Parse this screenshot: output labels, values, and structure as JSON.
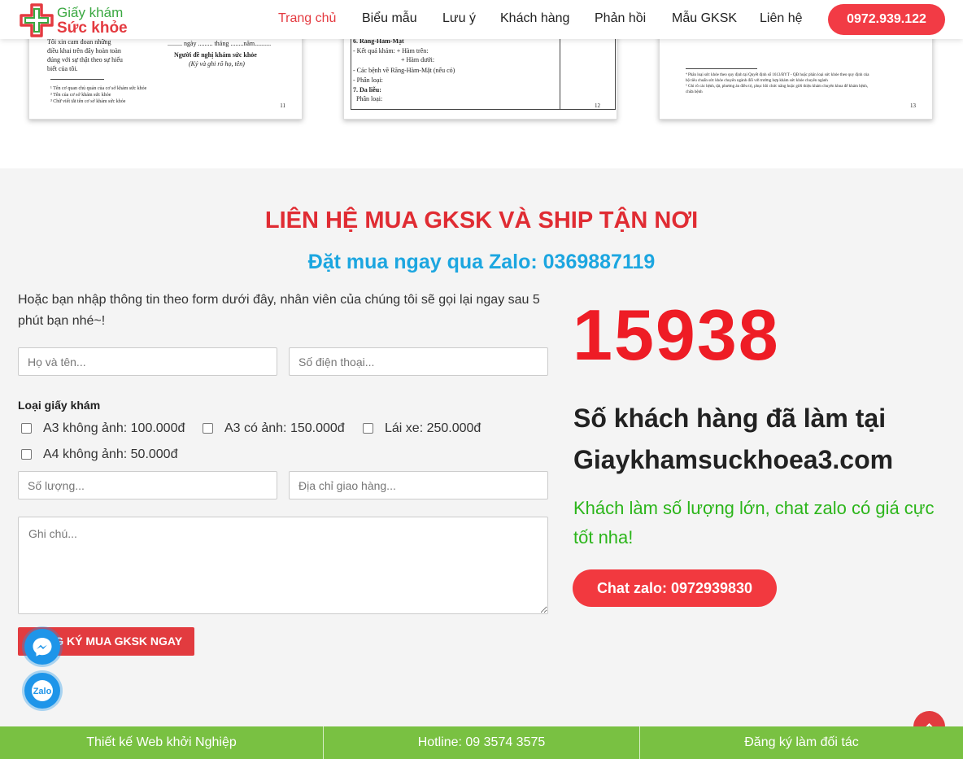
{
  "header": {
    "logo": {
      "line1": "Giấy khám",
      "line2": "Sức khỏe"
    },
    "nav": [
      {
        "label": "Trang chủ",
        "active": true
      },
      {
        "label": "Biểu mẫu",
        "active": false
      },
      {
        "label": "Lưu ý",
        "active": false
      },
      {
        "label": "Khách hàng",
        "active": false
      },
      {
        "label": "Phản hồi",
        "active": false
      },
      {
        "label": "Mẫu GKSK",
        "active": false
      },
      {
        "label": "Liên hệ",
        "active": false
      }
    ],
    "phone_button": "0972.939.122"
  },
  "documents": [
    {
      "page": "11",
      "lines": [
        "Tôi xin cam đoan những",
        "điều khai trên đây hoàn toàn",
        "đúng với sự thật theo sự hiểu",
        "biết của tôi.",
        "......... ngày ......... tháng ........năm..........",
        "Người đề nghị khám sức khỏe",
        "(Ký và ghi rõ họ, tên)",
        "¹ Tên cơ quan chủ quản của cơ sở khám sức khỏe",
        "² Tên của cơ sở khám sức khỏe",
        "³ Chữ viết tắt tên cơ sở khám sức khỏe"
      ]
    },
    {
      "page": "12",
      "lines": [
        "6. Răng-Hàm-Mặt",
        "- Kết quả khám: + Hàm trên:",
        "+ Hàm dưới:",
        "- Các bệnh về Răng-Hàm-Mặt (nếu có)",
        "- Phân loại:",
        "7. Da liễu:",
        "Phân loại:"
      ]
    },
    {
      "page": "13",
      "lines": [
        "⁴ Phân loại sức khỏe theo quy định tại Quyết định số 1613/BYT - QĐ hoặc phân loại sức khỏe theo quy định của",
        "bộ tiêu chuẩn sức khỏe chuyên ngành đối với trường hợp khám sức khỏe chuyên ngành",
        "⁵ Ghi rõ các bệnh, tật, phương án điều trị, phục hồi chức năng hoặc giới thiệu khám chuyên khoa để khám bệnh,",
        "chữa bệnh"
      ]
    }
  ],
  "contact": {
    "title": "LIÊN HỆ MUA GKSK VÀ SHIP TẬN NƠI",
    "subtitle": "Đặt mua ngay qua Zalo: 0369887119",
    "intro": "Hoặc bạn nhập thông tin theo form dưới đây, nhân viên của chúng tôi sẽ gọi lại ngay sau 5 phút bạn nhé~!",
    "form": {
      "name_placeholder": "Họ và tên...",
      "phone_placeholder": "Số điện thoại...",
      "type_label": "Loại giấy khám",
      "options": [
        "A3 không ảnh: 100.000đ",
        "A3 có ảnh: 150.000đ",
        "Lái xe: 250.000đ",
        "A4 không ảnh: 50.000đ"
      ],
      "quantity_placeholder": "Số lượng...",
      "address_placeholder": "Địa chỉ giao hàng...",
      "note_placeholder": "Ghi chú...",
      "submit_label": "ĐĂNG KÝ MUA GKSK NGAY"
    },
    "counter": "15938",
    "customers_line1": "Số khách hàng đã làm tại",
    "customers_line2": "Giaykhamsuckhoea3.com",
    "bulk_note": "Khách làm số lượng lớn, chat zalo có giá cực tốt nha!",
    "zalo_button": "Chat zalo: 0972939830"
  },
  "floating": {
    "zalo_label": "Zalo"
  },
  "footer": {
    "items": [
      "Thiết kế Web khởi Nghiệp",
      "Hotline: 09 3574 3575",
      "Đăng ký làm đối tác"
    ]
  },
  "colors": {
    "brand_red": "#e43a40",
    "brand_green": "#3aa841",
    "zalo_blue": "#1ca6e0",
    "footer_green": "#79c142"
  }
}
